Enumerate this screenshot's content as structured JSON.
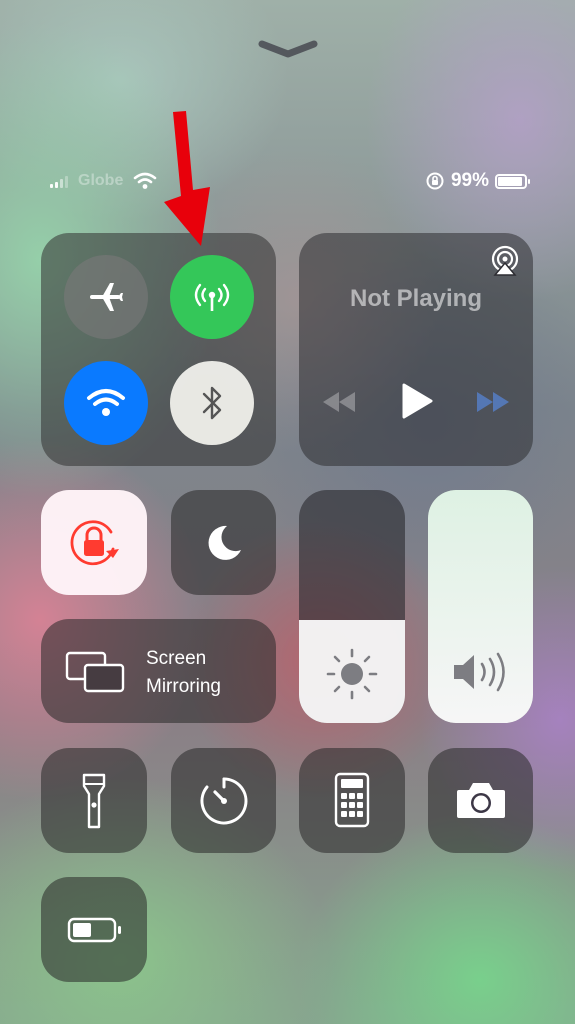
{
  "status_bar": {
    "carrier": "Globe",
    "battery_percent": "99%"
  },
  "connectivity": {
    "airplane": {
      "icon": "airplane-icon",
      "on": false
    },
    "cellular_data": {
      "icon": "antenna-icon",
      "on": true,
      "color": "#34C759"
    },
    "wifi": {
      "icon": "wifi-icon",
      "on": true,
      "color": "#0A7AFF"
    },
    "bluetooth": {
      "icon": "bluetooth-icon",
      "on": false
    }
  },
  "now_playing": {
    "title": "Not Playing",
    "airplay_icon": "airplay-icon",
    "controls": [
      "rewind-icon",
      "play-icon",
      "fast-forward-icon"
    ]
  },
  "toggles": {
    "orientation_lock": {
      "icon": "rotation-lock-icon",
      "on": true,
      "color": "#FF3B30"
    },
    "do_not_disturb": {
      "icon": "moon-icon",
      "on": false
    }
  },
  "screen_mirroring": {
    "label_line1": "Screen",
    "label_line2": "Mirroring",
    "icon": "screen-mirroring-icon"
  },
  "sliders": {
    "brightness": {
      "icon": "sun-icon",
      "level": 0.44
    },
    "volume": {
      "icon": "speaker-icon",
      "level": 1.0
    }
  },
  "shortcuts": [
    {
      "name": "flashlight",
      "icon": "flashlight-icon"
    },
    {
      "name": "timer",
      "icon": "timer-icon"
    },
    {
      "name": "calculator",
      "icon": "calculator-icon"
    },
    {
      "name": "camera",
      "icon": "camera-icon"
    },
    {
      "name": "low-power-mode",
      "icon": "battery-icon"
    }
  ],
  "annotation": {
    "icon": "red-arrow-icon",
    "color": "#E8000B"
  }
}
